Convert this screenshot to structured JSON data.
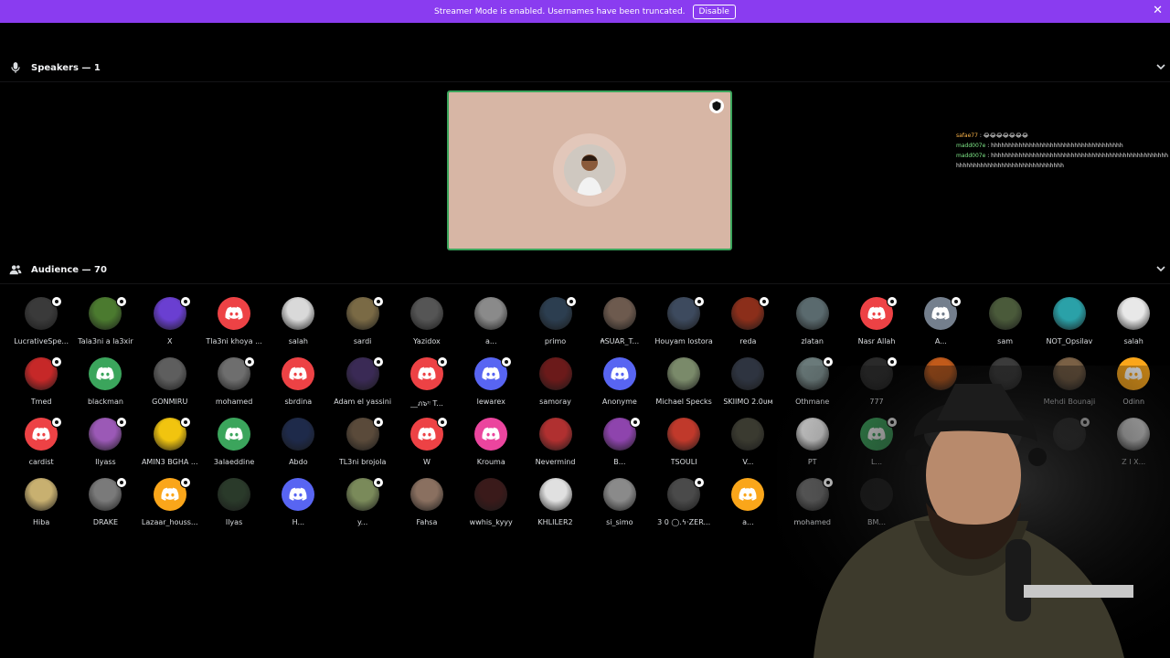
{
  "banner": {
    "message": "Streamer Mode is enabled. Usernames have been truncated.",
    "disable_label": "Disable",
    "close_glyph": "✕"
  },
  "speakers": {
    "title": "Speakers — 1",
    "icon": "microphone-icon"
  },
  "audience": {
    "title": "Audience — 70",
    "icon": "people-icon"
  },
  "chat": [
    {
      "user": "safae77",
      "sep": " : ",
      "text": "😂😂😂😂😂😂😂",
      "color": "#ffb74a"
    },
    {
      "user": "madd007e",
      "sep": " : ",
      "text": "hhhhhhhhhhhhhhhhhhhhhhhhhhhhhhhhhhhhhh",
      "color": "#7ee787"
    },
    {
      "user": "madd007e",
      "sep": " : ",
      "text": "hhhhhhhhhhhhhhhhhhhhhhhhhhhhhhhhhhhhhhhhhhhhhhhhhhhhhhhhhhhhhhhhhhhhhhhhhhhhhhhhhh",
      "color": "#7ee787"
    }
  ],
  "colors": {
    "banner": "#8a3cf0",
    "speaking_border": "#3ba55c",
    "discord_red": "#ed4245",
    "discord_green": "#3ba55c",
    "discord_blurple": "#5865f2",
    "discord_yellow": "#faa61a",
    "discord_pink": "#eb459e",
    "discord_grey": "#747f8d"
  },
  "members": [
    {
      "name": "LucrativeSpe...",
      "type": "photo",
      "bg": "#3a3a3a",
      "mark": true
    },
    {
      "name": "Tala3ni a la3xir",
      "type": "photo",
      "bg": "#4b7a2f",
      "mark": true
    },
    {
      "name": "X",
      "type": "photo",
      "bg": "#6a3fd1",
      "mark": true
    },
    {
      "name": "Tla3ni khoya ...",
      "type": "discord",
      "bg": "#ed4245",
      "mark": false
    },
    {
      "name": "salah",
      "type": "photo",
      "bg": "#d9d9d9",
      "mark": false
    },
    {
      "name": "sardi",
      "type": "photo",
      "bg": "#7a6a45",
      "mark": true
    },
    {
      "name": "Yazidox",
      "type": "photo",
      "bg": "#555555",
      "mark": false
    },
    {
      "name": "a...",
      "type": "photo",
      "bg": "#8a8a8a",
      "mark": false
    },
    {
      "name": "primo",
      "type": "photo",
      "bg": "#2c3e50",
      "mark": true
    },
    {
      "name": "₳SUAR_T...",
      "type": "photo",
      "bg": "#6d5a4e",
      "mark": false
    },
    {
      "name": "Houyam lostora",
      "type": "photo",
      "bg": "#3d4a5e",
      "mark": true
    },
    {
      "name": "reda",
      "type": "photo",
      "bg": "#8b2e1a",
      "mark": true
    },
    {
      "name": "zlatan",
      "type": "photo",
      "bg": "#5a6a6e",
      "mark": false
    },
    {
      "name": "Nasr Allah",
      "type": "discord",
      "bg": "#ed4245",
      "mark": true
    },
    {
      "name": "A...",
      "type": "discord",
      "bg": "#747f8d",
      "mark": true
    },
    {
      "name": "sam",
      "type": "photo",
      "bg": "#4a5a3a",
      "mark": false
    },
    {
      "name": "NOT_Opsilav",
      "type": "photo",
      "bg": "#2aa1a8",
      "mark": false
    },
    {
      "name": "salah",
      "type": "photo",
      "bg": "#e8e8e8",
      "mark": false
    },
    {
      "name": "Tmed",
      "type": "photo",
      "bg": "#c62828",
      "mark": true
    },
    {
      "name": "blackman",
      "type": "discord",
      "bg": "#3ba55c",
      "mark": false
    },
    {
      "name": "GONMIRU",
      "type": "photo",
      "bg": "#5e5e5e",
      "mark": false
    },
    {
      "name": "mohamed",
      "type": "photo",
      "bg": "#6e6e6e",
      "mark": true
    },
    {
      "name": "sbrdina",
      "type": "discord",
      "bg": "#ed4245",
      "mark": false
    },
    {
      "name": "Adam el yassini",
      "type": "photo",
      "bg": "#3a2a55",
      "mark": true
    },
    {
      "name": "__ภ๖ᶦᵎ T...",
      "type": "discord",
      "bg": "#ed4245",
      "mark": true
    },
    {
      "name": "lewarex",
      "type": "discord",
      "bg": "#5865f2",
      "mark": true
    },
    {
      "name": "samoray",
      "type": "photo",
      "bg": "#6b1a1a",
      "mark": false
    },
    {
      "name": "Anonyme",
      "type": "discord",
      "bg": "#5865f2",
      "mark": false
    },
    {
      "name": "Michael Specks",
      "type": "photo",
      "bg": "#7a8a6a",
      "mark": false
    },
    {
      "name": "SKIIMO 2.0ᴜᴍ",
      "type": "photo",
      "bg": "#2e3440",
      "mark": false
    },
    {
      "name": "Othmane",
      "type": "photo",
      "bg": "#6a7a7a",
      "mark": true
    },
    {
      "name": "777",
      "type": "photo",
      "bg": "#2a2a2a",
      "mark": true
    },
    {
      "name": "",
      "type": "photo",
      "bg": "#c25a1a",
      "mark": false
    },
    {
      "name": "",
      "type": "photo",
      "bg": "#3b3b3b",
      "mark": false
    },
    {
      "name": "Mehdi Bounaji",
      "type": "photo",
      "bg": "#7a6045",
      "mark": false
    },
    {
      "name": "Odinn",
      "type": "discord",
      "bg": "#faa61a",
      "mark": false
    },
    {
      "name": "cardist",
      "type": "discord",
      "bg": "#ed4245",
      "mark": true
    },
    {
      "name": "Ilyass",
      "type": "photo",
      "bg": "#9b59b6",
      "mark": true
    },
    {
      "name": "AMIN3 BGHA ...",
      "type": "photo",
      "bg": "#f1c40f",
      "mark": true
    },
    {
      "name": "3alaeddine",
      "type": "discord",
      "bg": "#3ba55c",
      "mark": false
    },
    {
      "name": "Abdo",
      "type": "photo",
      "bg": "#1e2a4a",
      "mark": false
    },
    {
      "name": "TL3ni brojola",
      "type": "photo",
      "bg": "#5a4a3a",
      "mark": true
    },
    {
      "name": "W",
      "type": "discord",
      "bg": "#ed4245",
      "mark": true
    },
    {
      "name": "Krouma",
      "type": "discord",
      "bg": "#eb459e",
      "mark": false
    },
    {
      "name": "Nevermind",
      "type": "photo",
      "bg": "#b03030",
      "mark": false
    },
    {
      "name": "B...",
      "type": "photo",
      "bg": "#8e44ad",
      "mark": true
    },
    {
      "name": "TSOULI",
      "type": "photo",
      "bg": "#c0392b",
      "mark": false
    },
    {
      "name": "V...",
      "type": "photo",
      "bg": "#3a3a30",
      "mark": false
    },
    {
      "name": "PT",
      "type": "photo",
      "bg": "#e0e0e0",
      "mark": false
    },
    {
      "name": "L...",
      "type": "discord",
      "bg": "#3ba55c",
      "mark": true
    },
    {
      "name": "",
      "type": "photo",
      "bg": "#2a2a2a",
      "mark": false
    },
    {
      "name": "",
      "type": "photo",
      "bg": "#2a2a2a",
      "mark": false
    },
    {
      "name": "",
      "type": "photo",
      "bg": "#2a2a2a",
      "mark": true
    },
    {
      "name": "Z I X...",
      "type": "photo",
      "bg": "#f2f2f2",
      "mark": false
    },
    {
      "name": "Hiba",
      "type": "photo",
      "bg": "#c8b070",
      "mark": false
    },
    {
      "name": "DRAKE",
      "type": "photo",
      "bg": "#7a7a7a",
      "mark": true
    },
    {
      "name": "Lazaar_houss...",
      "type": "discord",
      "bg": "#faa61a",
      "mark": true
    },
    {
      "name": "Ilyas",
      "type": "photo",
      "bg": "#2a3a2a",
      "mark": false
    },
    {
      "name": "H...",
      "type": "discord",
      "bg": "#5865f2",
      "mark": false
    },
    {
      "name": "y...",
      "type": "photo",
      "bg": "#7a8a5a",
      "mark": true
    },
    {
      "name": "Fahsa",
      "type": "photo",
      "bg": "#8a7060",
      "mark": false
    },
    {
      "name": "wwhis_kyyy",
      "type": "photo",
      "bg": "#3a1a1a",
      "mark": false
    },
    {
      "name": "KHLILER2",
      "type": "photo",
      "bg": "#e0e0e0",
      "mark": false
    },
    {
      "name": "si_simo",
      "type": "photo",
      "bg": "#8a8a8a",
      "mark": false
    },
    {
      "name": "3 0 ◯.ϟ·ZER...",
      "type": "photo",
      "bg": "#4a4a4a",
      "mark": true
    },
    {
      "name": "a...",
      "type": "discord",
      "bg": "#faa61a",
      "mark": false
    },
    {
      "name": "mohamed",
      "type": "photo",
      "bg": "#6a6a6a",
      "mark": true
    },
    {
      "name": "BM...",
      "type": "photo",
      "bg": "#1a1a1a",
      "mark": false
    }
  ]
}
